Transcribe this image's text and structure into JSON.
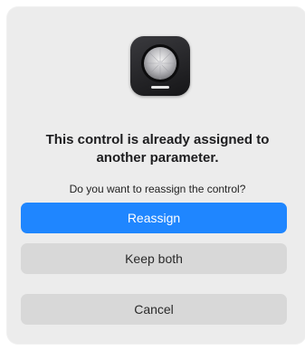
{
  "dialog": {
    "icon": "logic-pro-app-icon",
    "title": "This control is already assigned to another parameter.",
    "message": "Do you want to reassign the control?",
    "buttons": {
      "reassign": "Reassign",
      "keep_both": "Keep both",
      "cancel": "Cancel"
    }
  },
  "colors": {
    "primary_button": "#1f86ff",
    "secondary_button": "#d8d8d8",
    "dialog_background": "#ececec"
  }
}
